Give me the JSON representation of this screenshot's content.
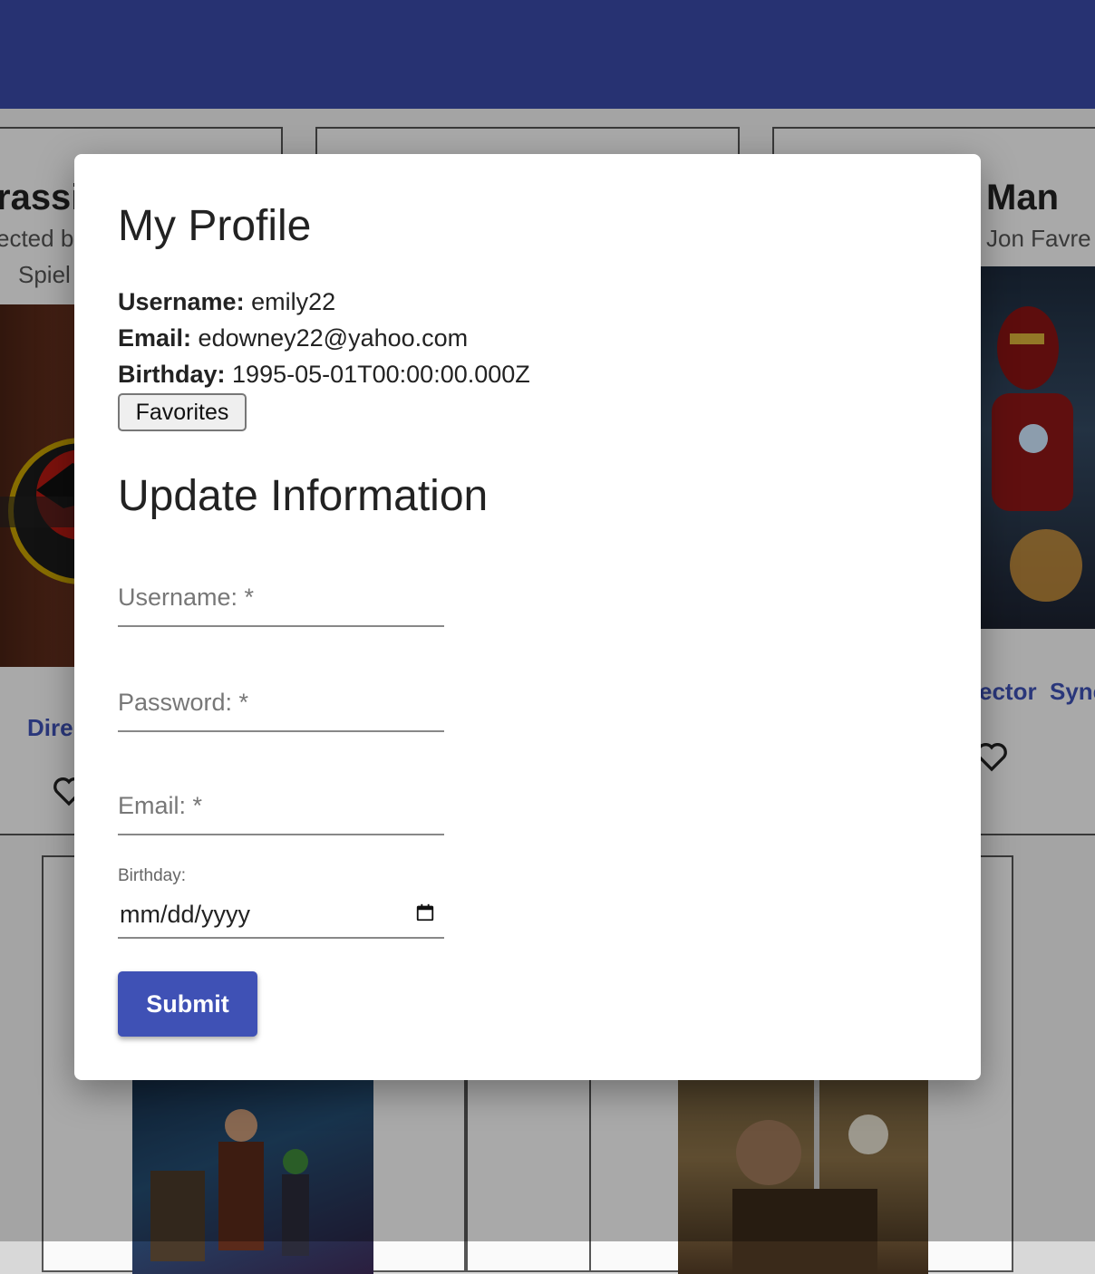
{
  "background": {
    "cards": [
      {
        "title": "rassi",
        "director_lines": [
          "ected b",
          "Spiel"
        ],
        "link": "Dire"
      },
      {
        "title": "Man",
        "director_lines": [
          "Jon Favre"
        ],
        "links": [
          "ector",
          "Sync"
        ]
      }
    ]
  },
  "profile": {
    "heading": "My Profile",
    "username_label": "Username:",
    "username_value": "emily22",
    "email_label": "Email:",
    "email_value": "edowney22@yahoo.com",
    "birthday_label": "Birthday:",
    "birthday_value": "1995-05-01T00:00:00.000Z",
    "favorites_button": "Favorites"
  },
  "update_form": {
    "heading": "Update Information",
    "username_placeholder": "Username: *",
    "password_placeholder": "Password: *",
    "email_placeholder": "Email: *",
    "birthday_label": "Birthday:",
    "birthday_placeholder": "mm/dd/yyyy",
    "submit_label": "Submit"
  },
  "colors": {
    "appbar": "#3a4aa8",
    "primary": "#3f51b5"
  }
}
